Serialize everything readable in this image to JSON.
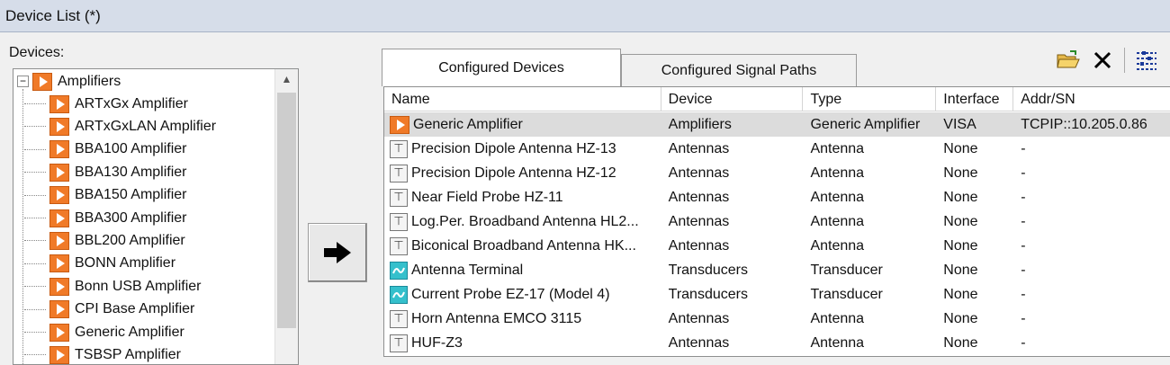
{
  "window": {
    "title": "Device List (*)"
  },
  "devices_panel": {
    "label": "Devices:",
    "category": {
      "expander": "−",
      "label": "Amplifiers"
    },
    "items": [
      "ARTxGx Amplifier",
      "ARTxGxLAN Amplifier",
      "BBA100 Amplifier",
      "BBA130 Amplifier",
      "BBA150 Amplifier",
      "BBA300 Amplifier",
      "BBL200 Amplifier",
      "BONN Amplifier",
      "Bonn USB Amplifier",
      "CPI Base Amplifier",
      "Generic Amplifier",
      "TSBSP Amplifier"
    ]
  },
  "add_button": {
    "icon": "arrow-right-icon"
  },
  "tabs": [
    {
      "label": "Configured Devices",
      "active": true
    },
    {
      "label": "Configured Signal Paths",
      "active": false
    }
  ],
  "toolbar": {
    "open": {
      "icon": "open-folder-icon"
    },
    "delete": {
      "icon": "delete-x-icon"
    },
    "properties": {
      "icon": "properties-list-icon"
    }
  },
  "grid": {
    "columns": [
      "Name",
      "Device",
      "Type",
      "Interface",
      "Addr/SN"
    ],
    "rows": [
      {
        "icon": "amplifier",
        "name": "Generic Amplifier",
        "device": "Amplifiers",
        "type": "Generic Amplifier",
        "interface": "VISA",
        "addr": "TCPIP::10.205.0.86",
        "selected": true
      },
      {
        "icon": "antenna",
        "name": "Precision Dipole Antenna HZ-13",
        "device": "Antennas",
        "type": "Antenna",
        "interface": "None",
        "addr": "-"
      },
      {
        "icon": "antenna",
        "name": "Precision Dipole Antenna HZ-12",
        "device": "Antennas",
        "type": "Antenna",
        "interface": "None",
        "addr": "-"
      },
      {
        "icon": "antenna",
        "name": "Near Field Probe HZ-11",
        "device": "Antennas",
        "type": "Antenna",
        "interface": "None",
        "addr": "-"
      },
      {
        "icon": "antenna",
        "name": "Log.Per. Broadband Antenna HL2...",
        "device": "Antennas",
        "type": "Antenna",
        "interface": "None",
        "addr": "-"
      },
      {
        "icon": "antenna",
        "name": "Biconical Broadband Antenna HK...",
        "device": "Antennas",
        "type": "Antenna",
        "interface": "None",
        "addr": "-"
      },
      {
        "icon": "transducer",
        "name": "Antenna Terminal",
        "device": "Transducers",
        "type": "Transducer",
        "interface": "None",
        "addr": "-"
      },
      {
        "icon": "transducer",
        "name": "Current Probe EZ-17 (Model 4)",
        "device": "Transducers",
        "type": "Transducer",
        "interface": "None",
        "addr": "-"
      },
      {
        "icon": "antenna",
        "name": "Horn Antenna EMCO 3115",
        "device": "Antennas",
        "type": "Antenna",
        "interface": "None",
        "addr": "-"
      },
      {
        "icon": "antenna",
        "name": "HUF-Z3",
        "device": "Antennas",
        "type": "Antenna",
        "interface": "None",
        "addr": "-"
      }
    ]
  },
  "colors": {
    "amplifier": "#f07a28",
    "transducer": "#35c0cc",
    "titlebar": "#d6dde9",
    "selected_row": "#dcdcdc"
  }
}
